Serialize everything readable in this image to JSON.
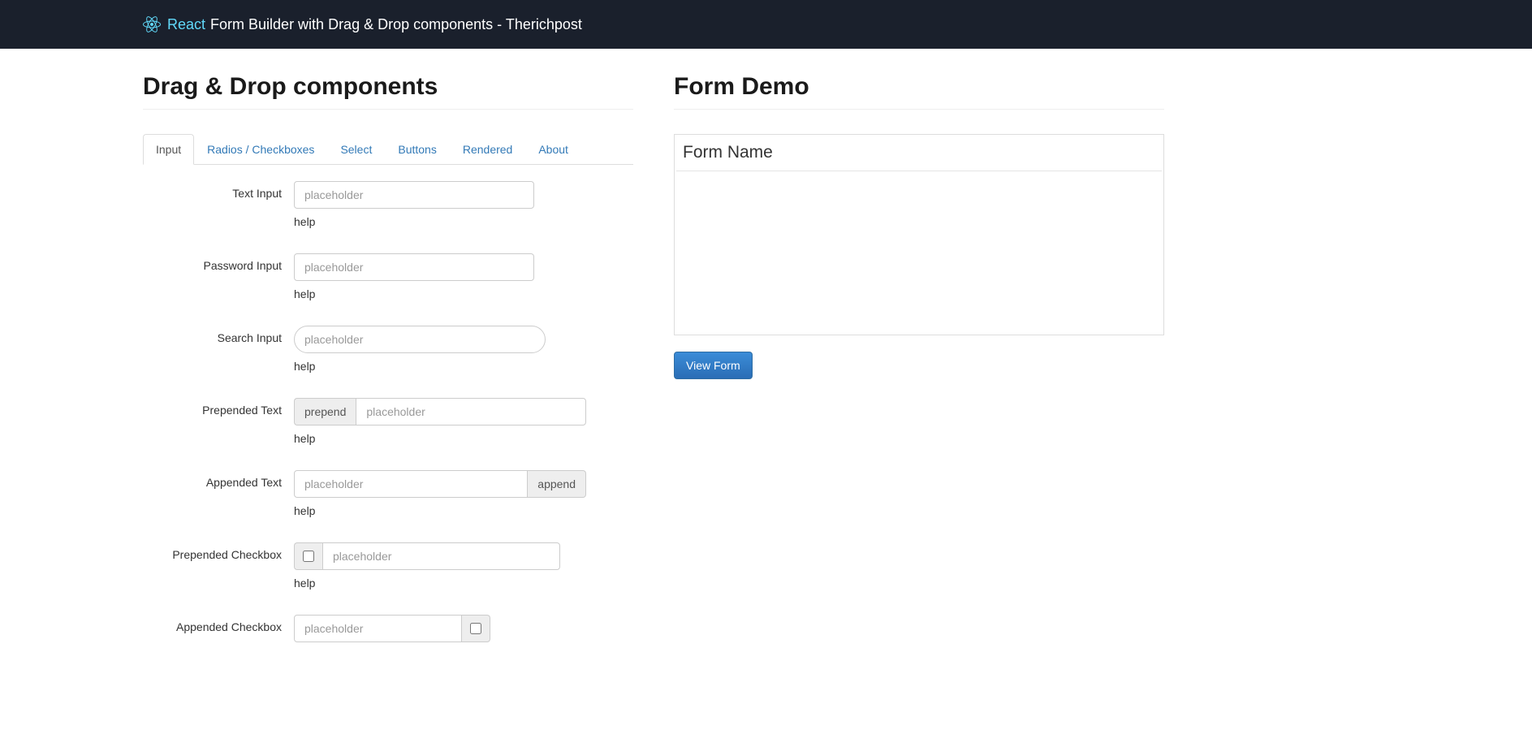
{
  "navbar": {
    "brand_link": "React",
    "brand_text": "Form Builder with Drag & Drop components - Therichpost"
  },
  "left": {
    "title": "Drag & Drop components",
    "tabs": [
      {
        "label": "Input",
        "active": true
      },
      {
        "label": "Radios / Checkboxes",
        "active": false
      },
      {
        "label": "Select",
        "active": false
      },
      {
        "label": "Buttons",
        "active": false
      },
      {
        "label": "Rendered",
        "active": false
      },
      {
        "label": "About",
        "active": false
      }
    ],
    "fields": {
      "text_input": {
        "label": "Text Input",
        "placeholder": "placeholder",
        "help": "help"
      },
      "password_input": {
        "label": "Password Input",
        "placeholder": "placeholder",
        "help": "help"
      },
      "search_input": {
        "label": "Search Input",
        "placeholder": "placeholder",
        "help": "help"
      },
      "prepended_text": {
        "label": "Prepended Text",
        "addon": "prepend",
        "placeholder": "placeholder",
        "help": "help"
      },
      "appended_text": {
        "label": "Appended Text",
        "addon": "append",
        "placeholder": "placeholder",
        "help": "help"
      },
      "prepended_checkbox": {
        "label": "Prepended Checkbox",
        "placeholder": "placeholder",
        "help": "help"
      },
      "appended_checkbox": {
        "label": "Appended Checkbox",
        "placeholder": "placeholder"
      }
    }
  },
  "right": {
    "title": "Form Demo",
    "legend": "Form Name",
    "button": "View Form"
  }
}
